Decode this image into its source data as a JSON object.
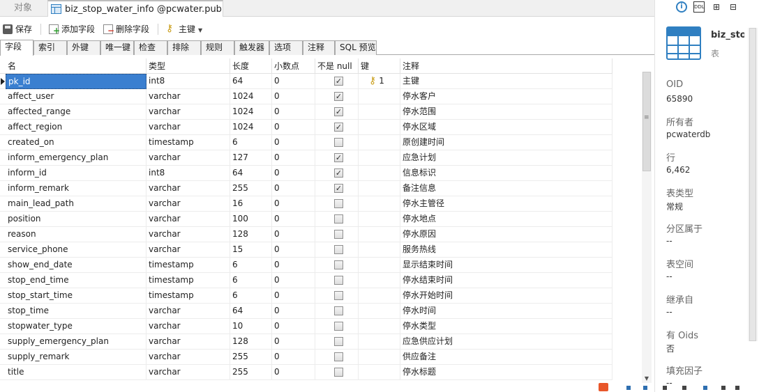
{
  "window_tabs": {
    "objects": "对象",
    "active": "biz_stop_water_info @pcwater.public..."
  },
  "toolbar": {
    "save": "保存",
    "add_field": "添加字段",
    "delete_field": "删除字段",
    "primary_key": "主键"
  },
  "subtabs": [
    "字段",
    "索引",
    "外键",
    "唯一键",
    "检查",
    "排除",
    "规则",
    "触发器",
    "选项",
    "注释",
    "SQL 预览"
  ],
  "grid": {
    "headers": [
      "名",
      "类型",
      "长度",
      "小数点",
      "不是 null",
      "键",
      "注释"
    ],
    "rows": [
      {
        "name": "pk_id",
        "type": "int8",
        "length": "64",
        "decimal": "0",
        "not_null": true,
        "key": "1",
        "comment": "主键"
      },
      {
        "name": "affect_user",
        "type": "varchar",
        "length": "1024",
        "decimal": "0",
        "not_null": true,
        "key": "",
        "comment": "停水客户"
      },
      {
        "name": "affected_range",
        "type": "varchar",
        "length": "1024",
        "decimal": "0",
        "not_null": true,
        "key": "",
        "comment": "停水范围"
      },
      {
        "name": "affect_region",
        "type": "varchar",
        "length": "1024",
        "decimal": "0",
        "not_null": true,
        "key": "",
        "comment": "停水区域"
      },
      {
        "name": "created_on",
        "type": "timestamp",
        "length": "6",
        "decimal": "0",
        "not_null": false,
        "key": "",
        "comment": "原创建时间"
      },
      {
        "name": "inform_emergency_plan",
        "type": "varchar",
        "length": "127",
        "decimal": "0",
        "not_null": true,
        "key": "",
        "comment": "应急计划"
      },
      {
        "name": "inform_id",
        "type": "int8",
        "length": "64",
        "decimal": "0",
        "not_null": true,
        "key": "",
        "comment": "信息标识"
      },
      {
        "name": "inform_remark",
        "type": "varchar",
        "length": "255",
        "decimal": "0",
        "not_null": true,
        "key": "",
        "comment": "备注信息"
      },
      {
        "name": "main_lead_path",
        "type": "varchar",
        "length": "16",
        "decimal": "0",
        "not_null": false,
        "key": "",
        "comment": "停水主管径"
      },
      {
        "name": "position",
        "type": "varchar",
        "length": "100",
        "decimal": "0",
        "not_null": false,
        "key": "",
        "comment": "停水地点"
      },
      {
        "name": "reason",
        "type": "varchar",
        "length": "128",
        "decimal": "0",
        "not_null": false,
        "key": "",
        "comment": "停水原因"
      },
      {
        "name": "service_phone",
        "type": "varchar",
        "length": "15",
        "decimal": "0",
        "not_null": false,
        "key": "",
        "comment": "服务热线"
      },
      {
        "name": "show_end_date",
        "type": "timestamp",
        "length": "6",
        "decimal": "0",
        "not_null": false,
        "key": "",
        "comment": "显示结束时间"
      },
      {
        "name": "stop_end_time",
        "type": "timestamp",
        "length": "6",
        "decimal": "0",
        "not_null": false,
        "key": "",
        "comment": "停水结束时间"
      },
      {
        "name": "stop_start_time",
        "type": "timestamp",
        "length": "6",
        "decimal": "0",
        "not_null": false,
        "key": "",
        "comment": "停水开始时间"
      },
      {
        "name": "stop_time",
        "type": "varchar",
        "length": "64",
        "decimal": "0",
        "not_null": false,
        "key": "",
        "comment": "停水时间"
      },
      {
        "name": "stopwater_type",
        "type": "varchar",
        "length": "10",
        "decimal": "0",
        "not_null": false,
        "key": "",
        "comment": "停水类型"
      },
      {
        "name": "supply_emergency_plan",
        "type": "varchar",
        "length": "128",
        "decimal": "0",
        "not_null": false,
        "key": "",
        "comment": "应急供应计划"
      },
      {
        "name": "supply_remark",
        "type": "varchar",
        "length": "255",
        "decimal": "0",
        "not_null": false,
        "key": "",
        "comment": "供应备注"
      },
      {
        "name": "title",
        "type": "varchar",
        "length": "255",
        "decimal": "0",
        "not_null": false,
        "key": "",
        "comment": "停水标题"
      }
    ]
  },
  "panel": {
    "object_name": "biz_sto",
    "object_kind": "表",
    "properties": [
      {
        "label": "OID",
        "value": "65890"
      },
      {
        "label": "所有者",
        "value": "pcwaterdb"
      },
      {
        "label": "行",
        "value": "6,462"
      },
      {
        "label": "表类型",
        "value": "常规"
      },
      {
        "label": "分区属于",
        "value": "--"
      },
      {
        "label": "表空间",
        "value": "--"
      },
      {
        "label": "继承自",
        "value": "--"
      },
      {
        "label": "有 Oids",
        "value": "否"
      },
      {
        "label": "填充因子",
        "value": "--"
      }
    ],
    "toolbar_icons": [
      "info-icon",
      "ddl-icon",
      "er-diagram-icon",
      "grid-icon"
    ]
  },
  "colors": {
    "selection": "#3a7fd0",
    "accent": "#2f7fc1",
    "key": "#c79a12"
  }
}
